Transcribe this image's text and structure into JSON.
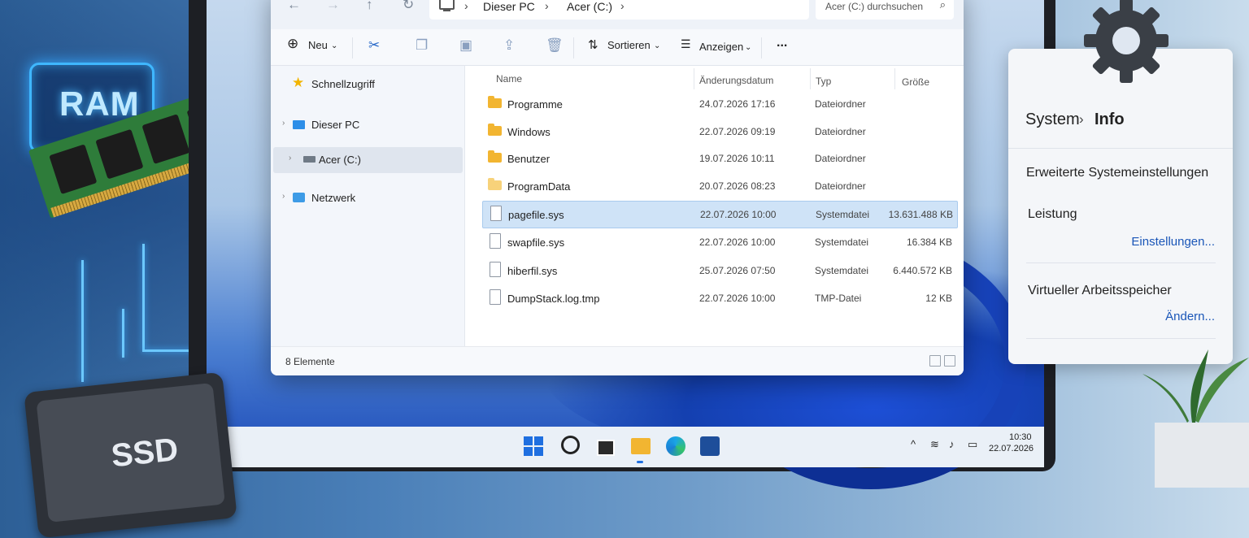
{
  "hardware": {
    "ram_label": "RAM",
    "ssd_label": "SSD"
  },
  "explorer": {
    "breadcrumb": [
      "Dieser PC",
      "Acer (C:)"
    ],
    "search_placeholder": "Acer (C:) durchsuchen",
    "toolbar": {
      "new": "Neu",
      "sort": "Sortieren",
      "view": "Anzeigen",
      "more": "..."
    },
    "sidebar": [
      {
        "label": "Schnellzugriff",
        "icon": "star-icon"
      },
      {
        "label": "Dieser PC",
        "icon": "monitor-icon"
      },
      {
        "label": "Acer (C:)",
        "icon": "drive-icon",
        "selected": true
      },
      {
        "label": "Netzwerk",
        "icon": "network-icon"
      }
    ],
    "columns": [
      "Name",
      "Änderungsdatum",
      "Typ",
      "Größe"
    ],
    "rows": [
      {
        "name": "Programme",
        "date": "24.07.2026 17:16",
        "type": "Dateiordner",
        "size": ""
      },
      {
        "name": "Windows",
        "date": "22.07.2026 09:19",
        "type": "Dateiordner",
        "size": ""
      },
      {
        "name": "Benutzer",
        "date": "19.07.2026 10:11",
        "type": "Dateiordner",
        "size": ""
      },
      {
        "name": "ProgramData",
        "date": "20.07.2026 08:23",
        "type": "Dateiordner",
        "size": ""
      },
      {
        "name": "pagefile.sys",
        "date": "22.07.2026 10:00",
        "type": "Systemdatei",
        "size": "13.631.488 KB"
      },
      {
        "name": "swapfile.sys",
        "date": "22.07.2026 10:00",
        "type": "Systemdatei",
        "size": "16.384 KB"
      },
      {
        "name": "hiberfil.sys",
        "date": "25.07.2026 07:50",
        "type": "Systemdatei",
        "size": "6.440.572 KB"
      },
      {
        "name": "DumpStack.log.tmp",
        "date": "22.07.2026 10:00",
        "type": "TMP-Datei",
        "size": "12 KB"
      }
    ],
    "status": "8 Elemente"
  },
  "settings": {
    "crumb": "System",
    "title": "Info",
    "advanced": "Erweiterte Systemeinstellungen",
    "performance": "Leistung",
    "performance_link": "Einstellungen...",
    "virtual_memory": "Virtueller Arbeitsspeicher",
    "virtual_memory_link": "Ändern..."
  },
  "taskbar": {
    "time": "10:30",
    "date": "22.07.2026"
  },
  "colors": {
    "accent": "#1f6fe0",
    "selection": "#cfe3f7",
    "folder": "#f2b531",
    "glow": "#3fb7ff"
  }
}
